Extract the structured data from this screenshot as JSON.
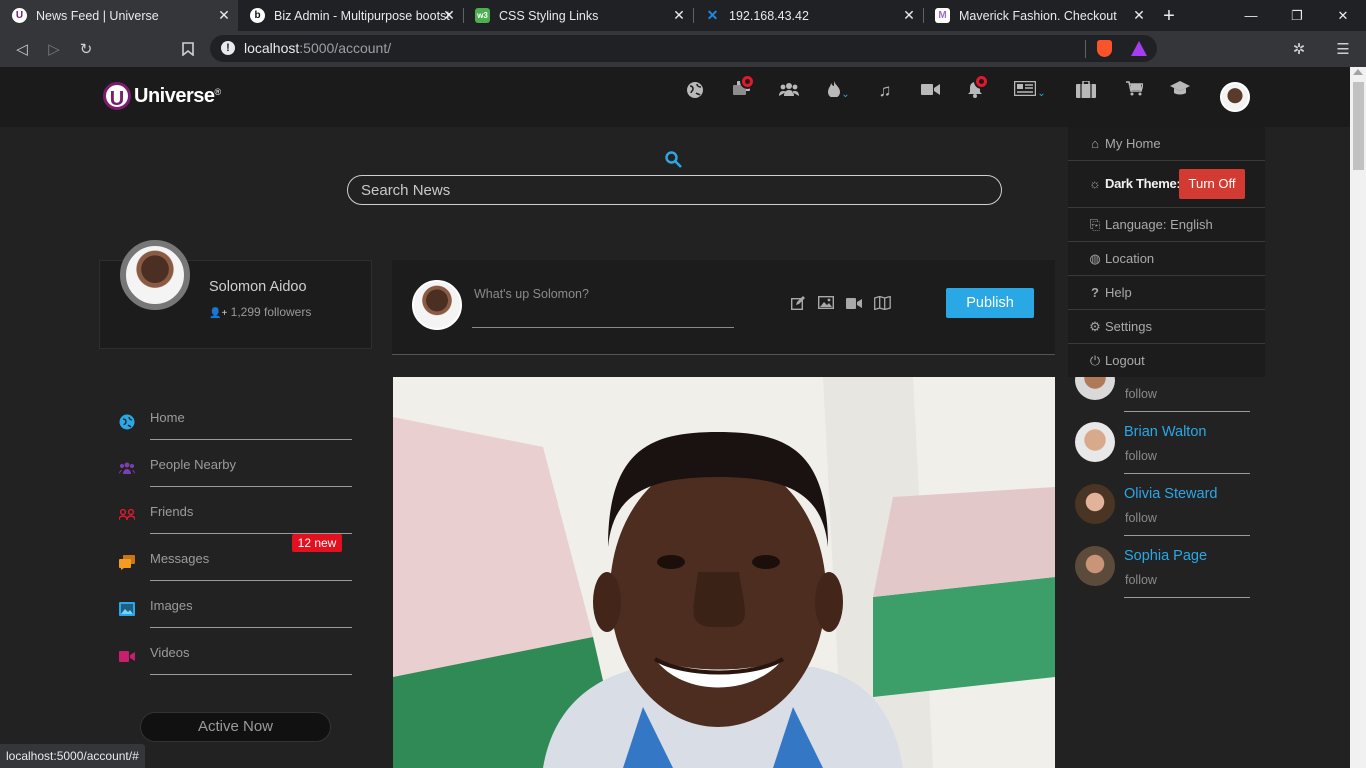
{
  "browser": {
    "tabs": [
      {
        "title": "News Feed | Universe",
        "favicon": "U",
        "favicon_color": "#7b1d6e",
        "active": true
      },
      {
        "title": "Biz Admin - Multipurpose bootst",
        "favicon": "b",
        "favicon_color": "#111111",
        "active": false
      },
      {
        "title": "CSS Styling Links",
        "favicon": "W3",
        "favicon_color": "#4caf50",
        "active": false
      },
      {
        "title": "192.168.43.42",
        "favicon": "X",
        "favicon_color": "#1e88e5",
        "active": false
      },
      {
        "title": "Maverick Fashion. Checkout",
        "favicon": "M",
        "favicon_color": "#9c6bd6",
        "active": false
      }
    ],
    "url_host": "localhost",
    "url_path": ":5000/account/",
    "status_url": "localhost:5000/account/#"
  },
  "header": {
    "logo_letter": "U",
    "logo_text": "Universe",
    "logo_reg": "®",
    "icons": [
      "globe-icon",
      "messages-icon",
      "groups-icon",
      "trending-icon",
      "music-icon",
      "video-icon",
      "bell-icon",
      "news-icon",
      "briefcase-icon",
      "cart-icon",
      "graduation-icon"
    ]
  },
  "search": {
    "placeholder": "Search News"
  },
  "profile": {
    "name": "Solomon Aidoo",
    "followers": "1,299 followers"
  },
  "left_nav": {
    "items": [
      {
        "label": "Home",
        "icon": "globe-icon",
        "color": "#2aa8e6"
      },
      {
        "label": "People Nearby",
        "icon": "people-icon",
        "color": "#7b3fb0"
      },
      {
        "label": "Friends",
        "icon": "friends-icon",
        "color": "#e0192f"
      },
      {
        "label": "Messages",
        "icon": "chat-icon",
        "color": "#f59a23"
      },
      {
        "label": "Images",
        "icon": "image-icon",
        "color": "#2aa8e6"
      },
      {
        "label": "Videos",
        "icon": "video-icon",
        "color": "#c81e6e"
      }
    ],
    "messages_badge": "12 new",
    "active_now": "Active Now"
  },
  "composer": {
    "placeholder": "What's up Solomon?",
    "publish_label": "Publish"
  },
  "follow_list": {
    "items": [
      {
        "name": "",
        "follow": "follow"
      },
      {
        "name": "Brian Walton",
        "follow": "follow"
      },
      {
        "name": "Olivia Steward",
        "follow": "follow"
      },
      {
        "name": "Sophia Page",
        "follow": "follow"
      }
    ]
  },
  "dropdown": {
    "my_home": "My Home",
    "dark_theme": "Dark Theme:",
    "turn_off": "Turn Off",
    "language": "Language: English",
    "location": "Location",
    "help": "Help",
    "settings": "Settings",
    "logout": "Logout"
  },
  "colors": {
    "accent": "#2aa8e6",
    "danger": "#d33a32",
    "background": "#232222"
  }
}
